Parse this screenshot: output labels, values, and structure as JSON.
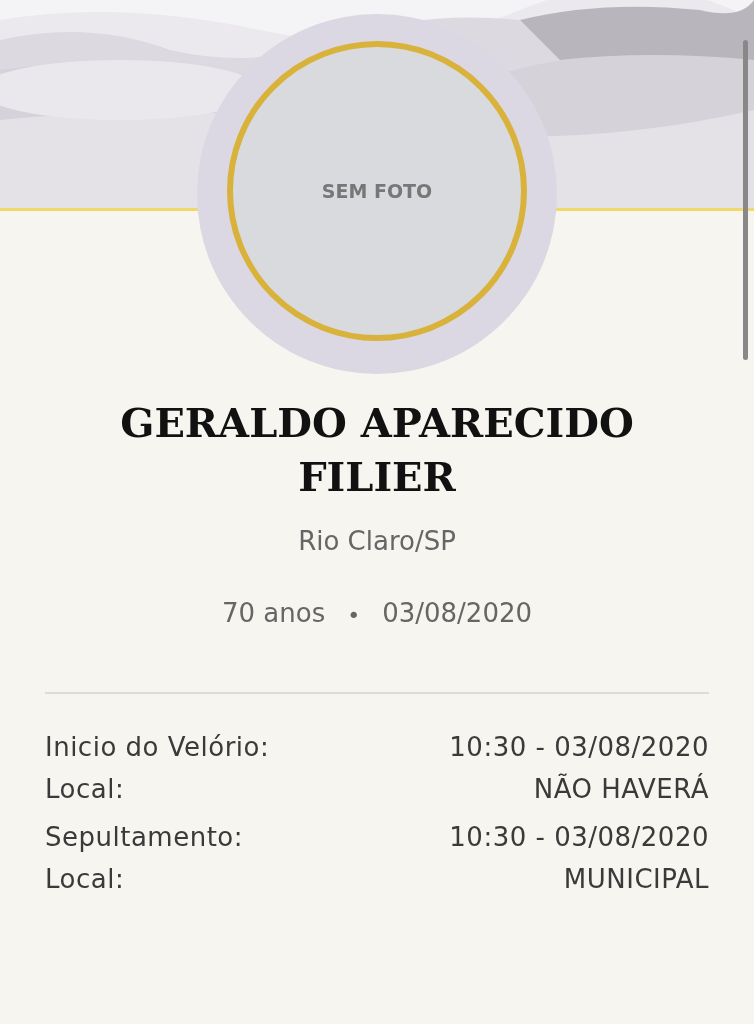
{
  "photo": {
    "placeholder_text": "SEM FOTO"
  },
  "name": "GERALDO APARECIDO FILIER",
  "city": "Rio Claro/SP",
  "age": "70 anos",
  "separator": "•",
  "date": "03/08/2020",
  "details": [
    {
      "label": "Inicio do Velório:",
      "value": "10:30 - 03/08/2020"
    },
    {
      "label": "Local:",
      "value": "NÃO HAVERÁ"
    },
    {
      "label": "Sepultamento:",
      "value": "10:30 - 03/08/2020"
    },
    {
      "label": "Local:",
      "value": "MUNICIPAL"
    }
  ]
}
